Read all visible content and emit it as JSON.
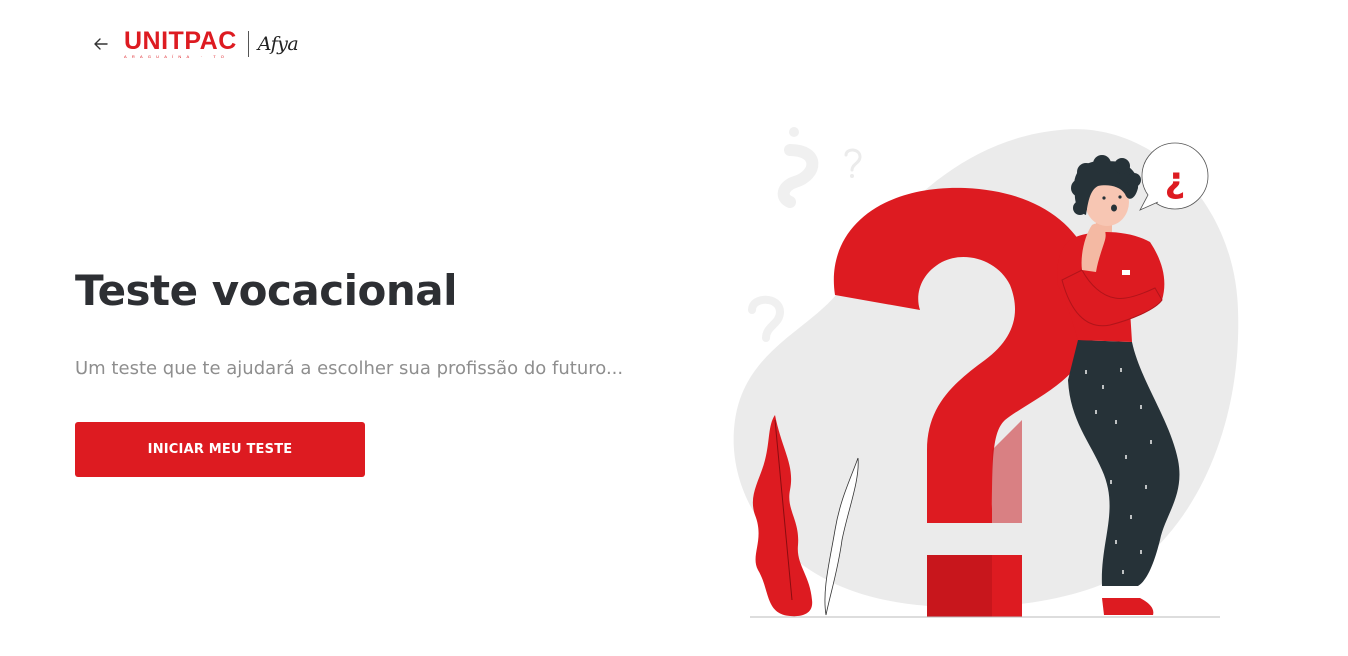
{
  "header": {
    "back_icon": "arrow-left-icon",
    "logo_text": "UNITPAC",
    "logo_subtext": "ARAGUAÍNA · TO",
    "partner_logo_text": "Afya"
  },
  "hero": {
    "title": "Teste vocacional",
    "subtitle": "Um teste que te ajudará a escolher sua profissão do futuro...",
    "cta_label": "INICIAR MEU TESTE"
  },
  "illustration": {
    "speech_bubble_text": "¿",
    "subject": "person-thinking-with-question-mark"
  },
  "colors": {
    "brand_red": "#dd1b21",
    "title_text": "#2d2f33",
    "subtitle_text": "#8e8e8e",
    "background": "#ffffff",
    "blob_gray": "#ebebeb",
    "pants_dark": "#263238"
  }
}
